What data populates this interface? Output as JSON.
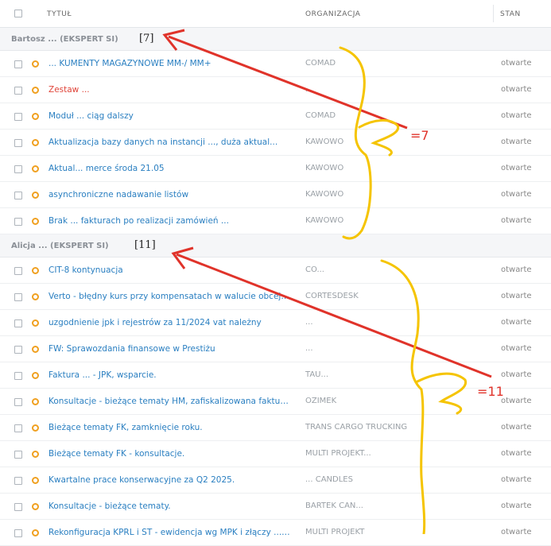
{
  "header": {
    "title_col": "TYTUŁ",
    "org_col": "ORGANIZACJA",
    "state_col": "STAN"
  },
  "groups": [
    {
      "name": "Bartosz ... (EKSPERT SI)",
      "count_label": "[7]",
      "rows": [
        {
          "title": "... KUMENTY MAGAZYNOWE MM-/ MM+",
          "org": "COMAD",
          "state": "otwarte",
          "title_color": "#2a7fc1"
        },
        {
          "title": "Zestaw ...",
          "org": "...",
          "state": "otwarte",
          "title_color": "#e0453a"
        },
        {
          "title": "Moduł ... ciąg dalszy",
          "org": "COMAD",
          "state": "otwarte",
          "title_color": "#2a7fc1"
        },
        {
          "title": "Aktualizacja bazy danych na instancji ..., duża aktual...",
          "org": "KAWOWO",
          "state": "otwarte",
          "title_color": "#2a7fc1"
        },
        {
          "title": "Aktual... merce środa 21.05",
          "org": "KAWOWO",
          "state": "otwarte",
          "title_color": "#2a7fc1"
        },
        {
          "title": "asynchroniczne nadawanie listów",
          "org": "KAWOWO",
          "state": "otwarte",
          "title_color": "#2a7fc1"
        },
        {
          "title": "Brak ... fakturach po realizacji zamówień ...",
          "org": "KAWOWO",
          "state": "otwarte",
          "title_color": "#2a7fc1"
        }
      ]
    },
    {
      "name": "Alicja ... (EKSPERT SI)",
      "count_label": "[11]",
      "rows": [
        {
          "title": "CIT-8 kontynuacja",
          "org": "CO...",
          "state": "otwarte",
          "title_color": "#2a7fc1"
        },
        {
          "title": "Verto - błędny kurs przy kompensatach w walucie obcej ...",
          "org": "CORTESDESK",
          "state": "otwarte",
          "title_color": "#2a7fc1"
        },
        {
          "title": "uzgodnienie jpk i rejestrów za 11/2024 vat należny",
          "org": "...",
          "state": "otwarte",
          "title_color": "#2a7fc1"
        },
        {
          "title": "FW: Sprawozdania finansowe w Prestiżu",
          "org": "...",
          "state": "otwarte",
          "title_color": "#2a7fc1"
        },
        {
          "title": "Faktura ... - JPK, wsparcie.",
          "org": "TAU...",
          "state": "otwarte",
          "title_color": "#2a7fc1"
        },
        {
          "title": "Konsultacje - bieżące tematy HM, zafiskalizowana faktura.",
          "org": "OZIMEK",
          "state": "otwarte",
          "title_color": "#2a7fc1"
        },
        {
          "title": "Bieżące tematy FK, zamknięcie roku.",
          "org": "TRANS CARGO TRUCKING",
          "state": "otwarte",
          "title_color": "#2a7fc1"
        },
        {
          "title": "Bieżące tematy FK - konsultacje.",
          "org": "MULTI PROJEKT...",
          "state": "otwarte",
          "title_color": "#2a7fc1"
        },
        {
          "title": "Kwartalne prace konserwacyjne za Q2 2025.",
          "org": "... CANDLES",
          "state": "otwarte",
          "title_color": "#2a7fc1"
        },
        {
          "title": "Konsultacje - bieżące tematy.",
          "org": "BARTEK CAN...",
          "state": "otwarte",
          "title_color": "#2a7fc1"
        },
        {
          "title": "Rekonfiguracja KPRL i ŚT - ewidencja wg MPK i złączy ... ech",
          "org": "MULTI PROJEKT",
          "state": "otwarte",
          "title_color": "#2a7fc1"
        }
      ]
    }
  ],
  "annotations": {
    "label_group1": "=7",
    "label_group2": "=11",
    "arrow_color": "#e0332a",
    "brace_color": "#f5c400"
  }
}
